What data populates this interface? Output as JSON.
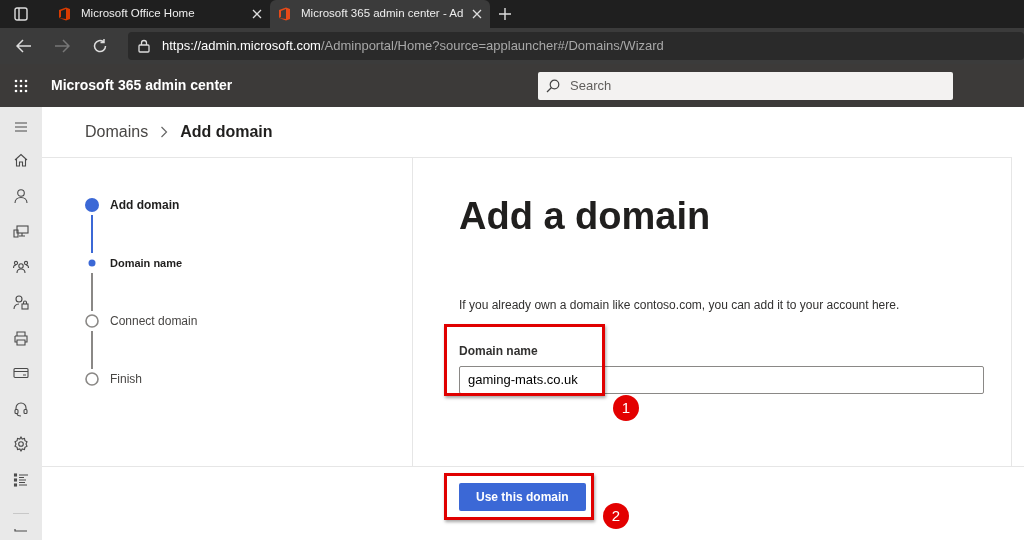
{
  "browser": {
    "tabs": [
      {
        "title": "Microsoft Office Home",
        "selected": false
      },
      {
        "title": "Microsoft 365 admin center - Ad",
        "selected": true
      }
    ],
    "url_host": "https://admin.microsoft.com",
    "url_path": "/Adminportal/Home?source=applauncher#/Domains/Wizard"
  },
  "header": {
    "title": "Microsoft 365 admin center",
    "search": {
      "placeholder": "Search"
    }
  },
  "breadcrumb": [
    {
      "label": "Domains",
      "selected": false
    },
    {
      "label": "Add domain",
      "selected": true
    }
  ],
  "steps": [
    {
      "label": "Add domain",
      "kind": "step",
      "selected": true
    },
    {
      "label": "Domain name",
      "kind": "substep",
      "selected": true
    },
    {
      "label": "Connect domain",
      "kind": "step",
      "selected": false
    },
    {
      "label": "Finish",
      "kind": "step",
      "selected": false
    }
  ],
  "form": {
    "title": "Add a domain",
    "description": "If you already own a domain like contoso.com, you can add it to your account here.",
    "field_label": "Domain name",
    "field_value": "gaming-mats.co.uk"
  },
  "footer": {
    "button": "Use this domain"
  },
  "annotations": [
    {
      "label": "1"
    },
    {
      "label": "2"
    }
  ]
}
